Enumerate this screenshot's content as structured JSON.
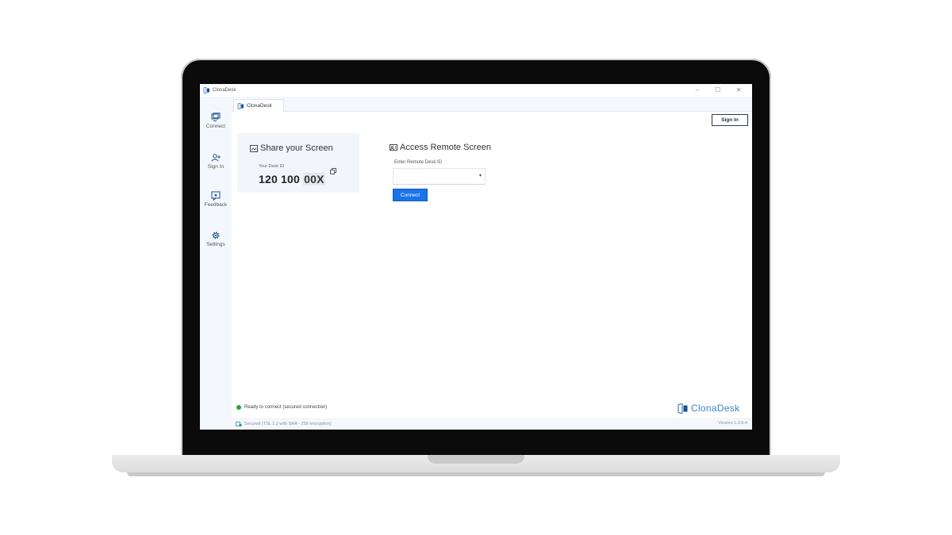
{
  "window": {
    "title": "ClonaDesk",
    "controls": {
      "minimize": "–",
      "maximize": "☐",
      "close": "✕"
    }
  },
  "sidebar": {
    "items": [
      {
        "label": "Connect",
        "icon": "monitor-icon"
      },
      {
        "label": "Sign In",
        "icon": "user-add-icon"
      },
      {
        "label": "Feedback",
        "icon": "feedback-icon"
      },
      {
        "label": "Settings",
        "icon": "gear-icon"
      }
    ]
  },
  "tab": {
    "label": "ClonaDesk"
  },
  "header": {
    "sign_in_label": "Sign In"
  },
  "share": {
    "title": "Share your Screen",
    "desk_id_label": "Your Desk ID",
    "desk_id_prefix": "120 100 ",
    "desk_id_masked": "00X"
  },
  "access": {
    "title": "Access Remote Screen",
    "input_label": "Enter Remote Desk ID",
    "input_value": "",
    "connect_label": "Connect"
  },
  "status": {
    "text": "Ready to connect (secured connection)",
    "color": "#2ea043"
  },
  "brand": {
    "name": "ClonaDesk",
    "color": "#3d86c6"
  },
  "footer": {
    "secured_text": "Secured (TSL 1.2 with SHA - 256 encryption)",
    "version": "Version 1.0.6.4"
  },
  "colors": {
    "primary": "#1a73e8",
    "sidebar_bg": "#f4f7fc"
  }
}
